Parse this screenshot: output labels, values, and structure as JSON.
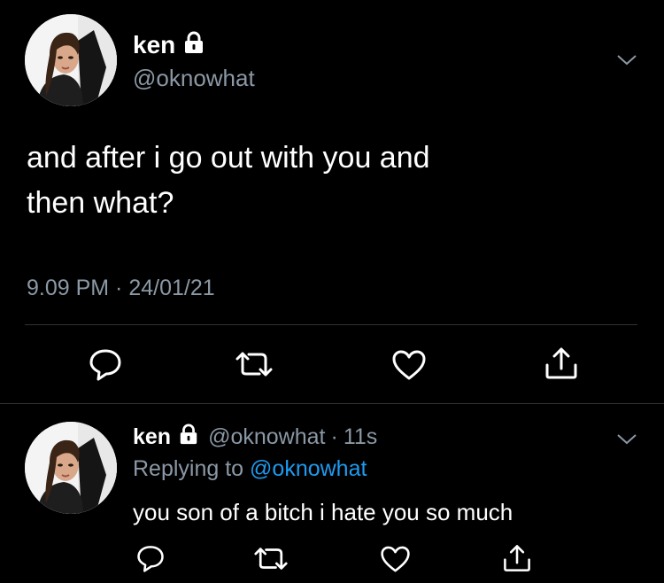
{
  "tweet": {
    "name": "ken",
    "handle": "@oknowhat",
    "text_line1": "and after i go out with you and",
    "text_line2": "then what?",
    "timestamp": "9.09 PM · 24/01/21"
  },
  "reply": {
    "name": "ken",
    "handle": "@oknowhat",
    "separator": "·",
    "age": "11s",
    "replying_prefix": "Replying to",
    "replying_to": "@oknowhat",
    "text": "you son of a bitch i hate you so much"
  },
  "icons": {
    "lock": "lock-icon",
    "more": "chevron-down-icon",
    "reply": "reply-icon",
    "retweet": "retweet-icon",
    "like": "heart-icon",
    "share": "share-icon"
  },
  "colors": {
    "background": "#000000",
    "text": "#ffffff",
    "secondary": "#8b98a5",
    "link": "#1d9bf0",
    "divider": "#2f3336"
  }
}
